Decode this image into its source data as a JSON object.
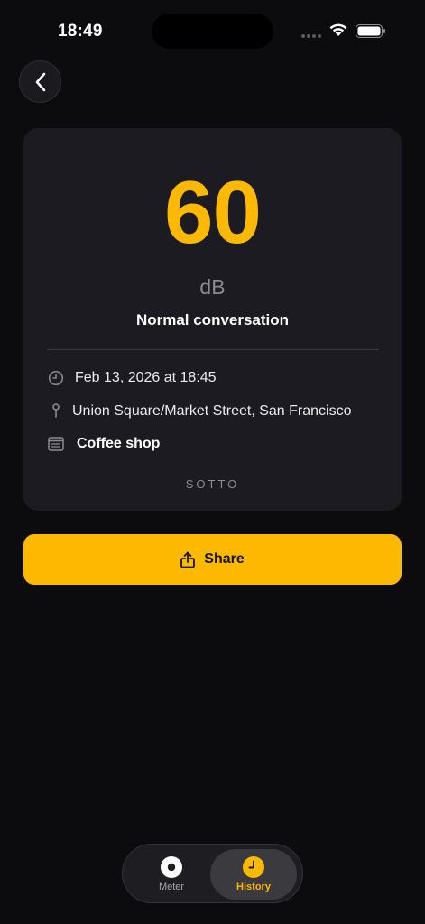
{
  "status_bar": {
    "time": "18:49"
  },
  "reading": {
    "value": "60",
    "unit": "dB",
    "description": "Normal conversation",
    "date": "Feb 13, 2026 at 18:45",
    "location": "Union Square/Market Street, San Francisco",
    "category": "Coffee shop",
    "brand": "SOTTO"
  },
  "actions": {
    "share_label": "Share"
  },
  "tab_bar": {
    "tabs": [
      {
        "label": "Meter",
        "icon": "meter-icon",
        "active": false
      },
      {
        "label": "History",
        "icon": "clock-icon",
        "active": true
      }
    ]
  },
  "colors": {
    "accent": "#fcb900",
    "background": "#0c0c0f",
    "card": "#1b1b21"
  }
}
